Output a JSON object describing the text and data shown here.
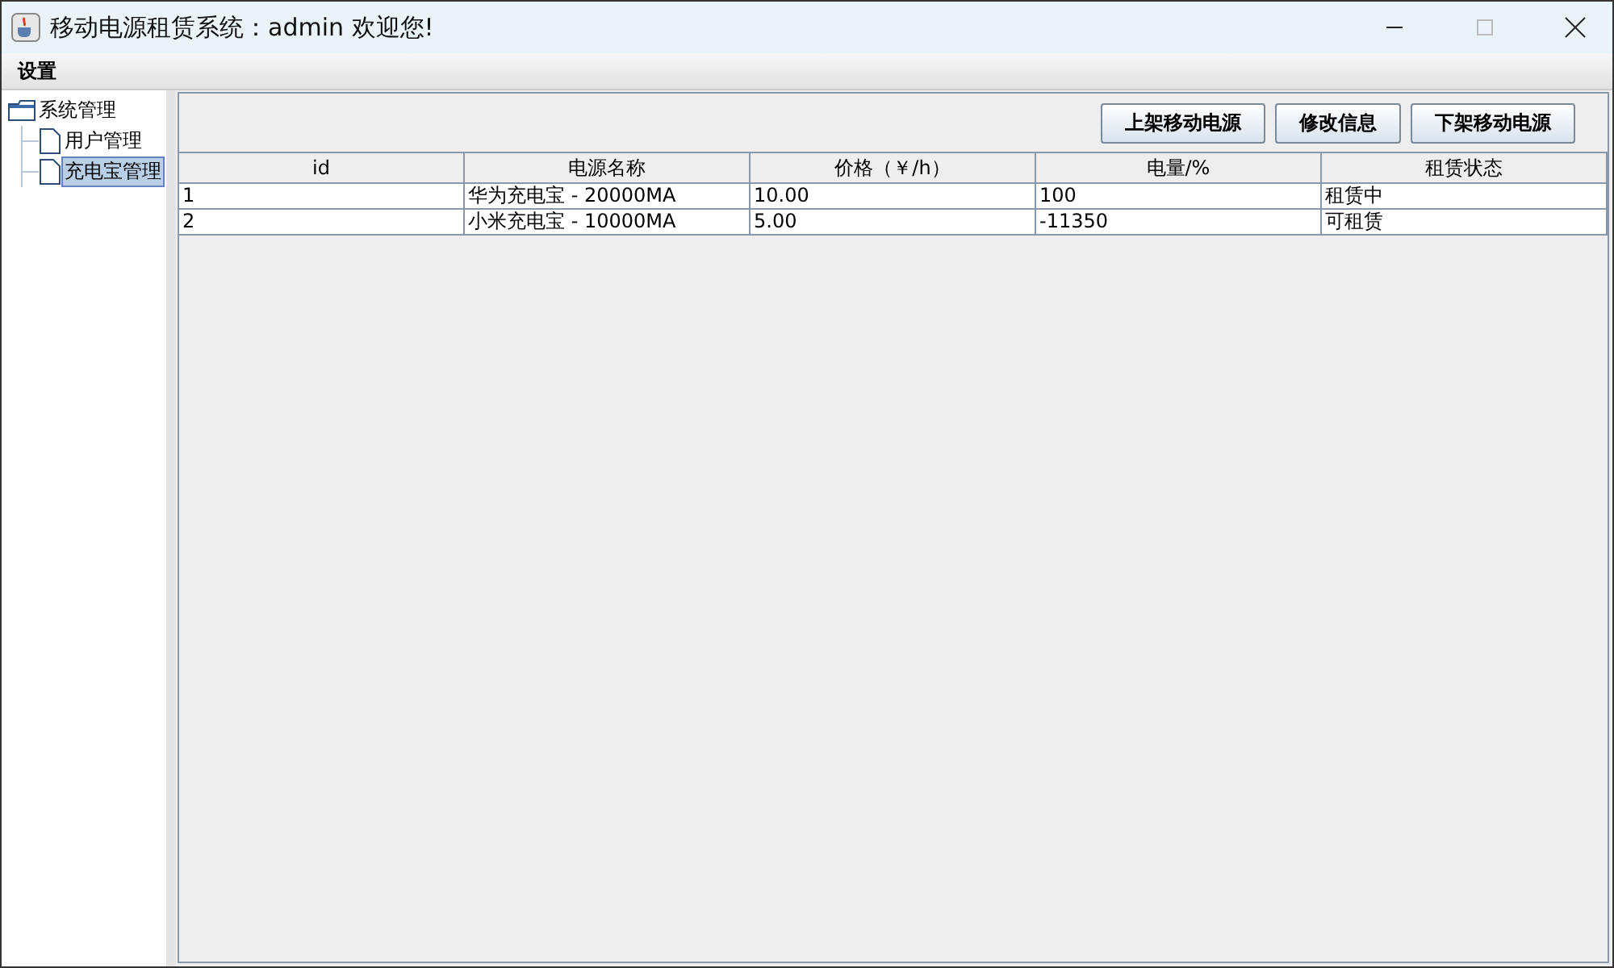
{
  "window": {
    "title": "移动电源租赁系统：admin 欢迎您!"
  },
  "menu": [
    "设置"
  ],
  "tree": {
    "label": "系统管理",
    "expanded": true,
    "children": [
      {
        "label": "用户管理",
        "selected": false
      },
      {
        "label": "充电宝管理",
        "selected": true
      }
    ]
  },
  "toolbar": [
    "上架移动电源",
    "修改信息",
    "下架移动电源"
  ],
  "table": {
    "columns": [
      "id",
      "电源名称",
      "价格（￥/h）",
      "电量/%",
      "租赁状态"
    ],
    "rows": [
      [
        "1",
        "华为充电宝 - 20000MA",
        "10.00",
        "100",
        "租赁中"
      ],
      [
        "2",
        "小米充电宝 - 10000MA",
        "5.00",
        "-11350",
        "可租赁"
      ]
    ]
  }
}
